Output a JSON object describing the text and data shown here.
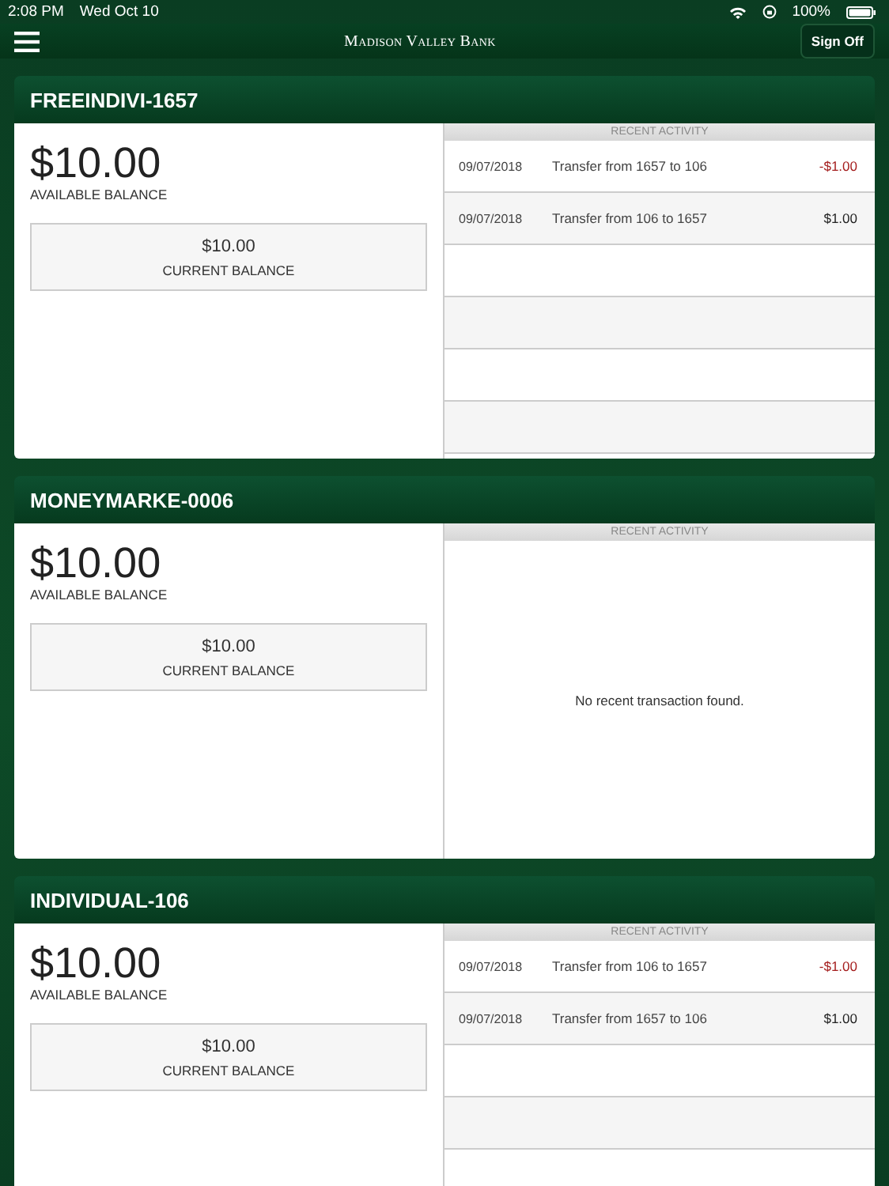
{
  "status_bar": {
    "time": "2:08 PM",
    "date": "Wed Oct 10",
    "battery": "100%"
  },
  "nav": {
    "title": "Madison Valley Bank",
    "sign_off": "Sign Off"
  },
  "accounts": [
    {
      "name": "FREEINDIVI-1657",
      "available": "$10.00",
      "available_label": "AVAILABLE BALANCE",
      "current": "$10.00",
      "current_label": "CURRENT BALANCE",
      "activity_title": "RECENT ACTIVITY",
      "transactions": [
        {
          "date": "09/07/2018",
          "description": "Transfer from 1657 to 106",
          "amount": "-$1.00",
          "negative": true
        },
        {
          "date": "09/07/2018",
          "description": "Transfer from 106 to 1657",
          "amount": "$1.00",
          "negative": false
        }
      ]
    },
    {
      "name": "MONEYMARKE-0006",
      "available": "$10.00",
      "available_label": "AVAILABLE BALANCE",
      "current": "$10.00",
      "current_label": "CURRENT BALANCE",
      "activity_title": "RECENT ACTIVITY",
      "empty_message": "No recent transaction found."
    },
    {
      "name": "INDIVIDUAL-106",
      "available": "$10.00",
      "available_label": "AVAILABLE BALANCE",
      "current": "$10.00",
      "current_label": "CURRENT BALANCE",
      "activity_title": "RECENT ACTIVITY",
      "transactions": [
        {
          "date": "09/07/2018",
          "description": "Transfer from 106 to 1657",
          "amount": "-$1.00",
          "negative": true
        },
        {
          "date": "09/07/2018",
          "description": "Transfer from 1657 to 106",
          "amount": "$1.00",
          "negative": false
        }
      ]
    }
  ]
}
